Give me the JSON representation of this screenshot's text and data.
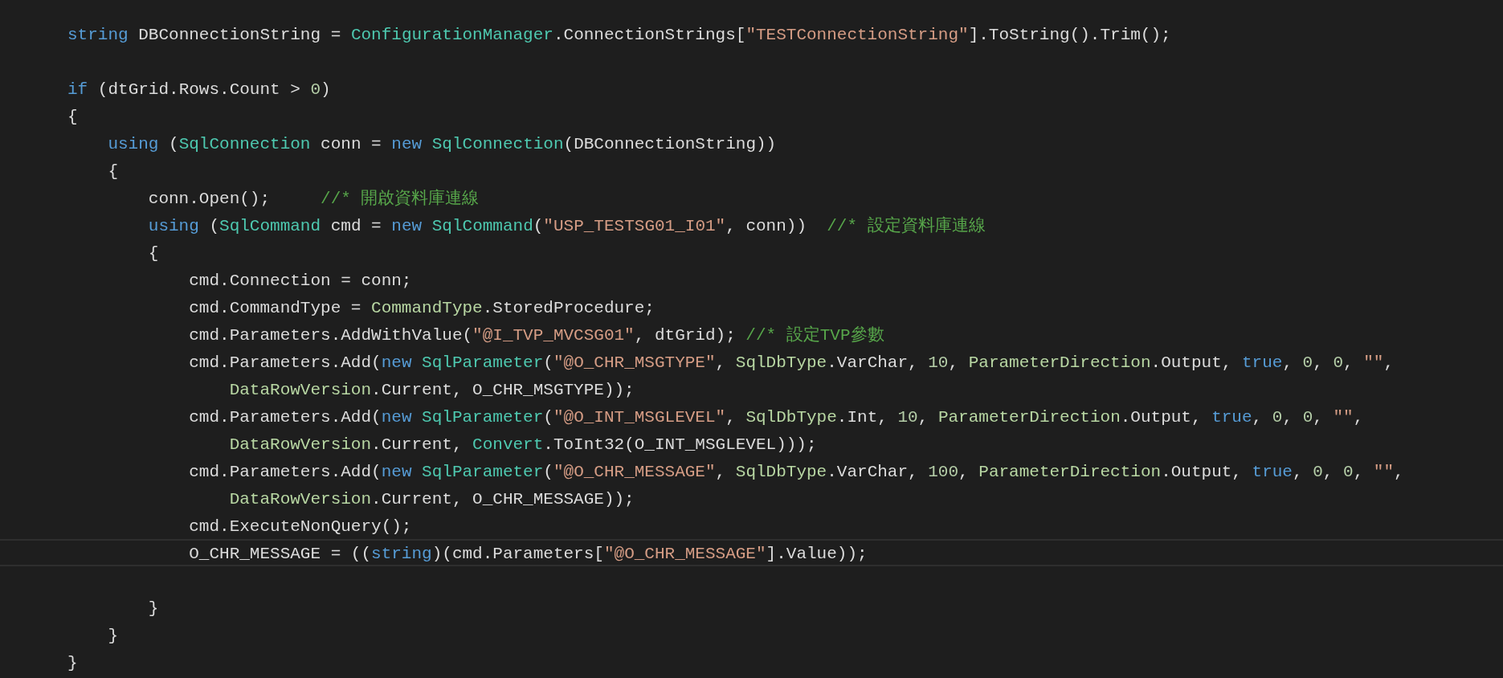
{
  "editor": {
    "lines": [
      {
        "current": false,
        "tokens": [
          {
            "kind": "keyword",
            "text": "string"
          },
          {
            "kind": "plain",
            "text": " DBConnectionString = "
          },
          {
            "kind": "type",
            "text": "ConfigurationManager"
          },
          {
            "kind": "plain",
            "text": ".ConnectionStrings["
          },
          {
            "kind": "string",
            "text": "\"TESTConnectionString\""
          },
          {
            "kind": "plain",
            "text": "].ToString().Trim();"
          }
        ]
      },
      {
        "current": false
      },
      {
        "current": false,
        "tokens": [
          {
            "kind": "keyword",
            "text": "if"
          },
          {
            "kind": "plain",
            "text": " (dtGrid.Rows.Count > "
          },
          {
            "kind": "number",
            "text": "0"
          },
          {
            "kind": "plain",
            "text": ")"
          }
        ]
      },
      {
        "current": false,
        "tokens": [
          {
            "kind": "plain",
            "text": "{"
          }
        ]
      },
      {
        "current": false,
        "tokens": [
          {
            "kind": "keyword",
            "text": "    using"
          },
          {
            "kind": "plain",
            "text": " ("
          },
          {
            "kind": "type",
            "text": "SqlConnection"
          },
          {
            "kind": "plain",
            "text": " conn = "
          },
          {
            "kind": "keyword",
            "text": "new "
          },
          {
            "kind": "type",
            "text": "SqlConnection"
          },
          {
            "kind": "plain",
            "text": "(DBConnectionString))"
          }
        ]
      },
      {
        "current": false,
        "tokens": [
          {
            "kind": "plain",
            "text": "    {"
          }
        ]
      },
      {
        "current": false,
        "tokens": [
          {
            "kind": "plain",
            "text": "        conn.Open();     "
          },
          {
            "kind": "comment",
            "text": "//* 開啟資料庫連線"
          }
        ]
      },
      {
        "current": false,
        "tokens": [
          {
            "kind": "keyword",
            "text": "        using"
          },
          {
            "kind": "plain",
            "text": " ("
          },
          {
            "kind": "type",
            "text": "SqlCommand"
          },
          {
            "kind": "plain",
            "text": " cmd = "
          },
          {
            "kind": "keyword",
            "text": "new "
          },
          {
            "kind": "type",
            "text": "SqlCommand"
          },
          {
            "kind": "plain",
            "text": "("
          },
          {
            "kind": "string",
            "text": "\"USP_TESTSG01_I01\""
          },
          {
            "kind": "plain",
            "text": ", conn))  "
          },
          {
            "kind": "comment",
            "text": "//* 設定資料庫連線"
          }
        ]
      },
      {
        "current": false,
        "tokens": [
          {
            "kind": "plain",
            "text": "        {"
          }
        ]
      },
      {
        "current": false,
        "tokens": [
          {
            "kind": "plain",
            "text": "            cmd.Connection = conn;"
          }
        ]
      },
      {
        "current": false,
        "tokens": [
          {
            "kind": "plain",
            "text": "            cmd.CommandType = "
          },
          {
            "kind": "enum",
            "text": "CommandType"
          },
          {
            "kind": "plain",
            "text": ".StoredProcedure;"
          }
        ]
      },
      {
        "current": false,
        "tokens": [
          {
            "kind": "plain",
            "text": "            cmd.Parameters.AddWithValue("
          },
          {
            "kind": "string",
            "text": "\"@I_TVP_MVCSG01\""
          },
          {
            "kind": "plain",
            "text": ", dtGrid); "
          },
          {
            "kind": "comment",
            "text": "//* 設定TVP參數"
          }
        ]
      },
      {
        "current": false,
        "tokens": [
          {
            "kind": "plain",
            "text": "            cmd.Parameters.Add("
          },
          {
            "kind": "keyword",
            "text": "new "
          },
          {
            "kind": "type",
            "text": "SqlParameter"
          },
          {
            "kind": "plain",
            "text": "("
          },
          {
            "kind": "string",
            "text": "\"@O_CHR_MSGTYPE\""
          },
          {
            "kind": "plain",
            "text": ", "
          },
          {
            "kind": "enum",
            "text": "SqlDbType"
          },
          {
            "kind": "plain",
            "text": ".VarChar, "
          },
          {
            "kind": "number",
            "text": "10"
          },
          {
            "kind": "plain",
            "text": ", "
          },
          {
            "kind": "enum",
            "text": "ParameterDirection"
          },
          {
            "kind": "plain",
            "text": ".Output, "
          },
          {
            "kind": "keyword",
            "text": "true"
          },
          {
            "kind": "plain",
            "text": ", "
          },
          {
            "kind": "number",
            "text": "0"
          },
          {
            "kind": "plain",
            "text": ", "
          },
          {
            "kind": "number",
            "text": "0"
          },
          {
            "kind": "plain",
            "text": ", "
          },
          {
            "kind": "string",
            "text": "\"\""
          },
          {
            "kind": "plain",
            "text": ","
          }
        ]
      },
      {
        "current": false,
        "tokens": [
          {
            "kind": "enum",
            "text": "                DataRowVersion"
          },
          {
            "kind": "plain",
            "text": ".Current, O_CHR_MSGTYPE));"
          }
        ]
      },
      {
        "current": false,
        "tokens": [
          {
            "kind": "plain",
            "text": "            cmd.Parameters.Add("
          },
          {
            "kind": "keyword",
            "text": "new "
          },
          {
            "kind": "type",
            "text": "SqlParameter"
          },
          {
            "kind": "plain",
            "text": "("
          },
          {
            "kind": "string",
            "text": "\"@O_INT_MSGLEVEL\""
          },
          {
            "kind": "plain",
            "text": ", "
          },
          {
            "kind": "enum",
            "text": "SqlDbType"
          },
          {
            "kind": "plain",
            "text": ".Int, "
          },
          {
            "kind": "number",
            "text": "10"
          },
          {
            "kind": "plain",
            "text": ", "
          },
          {
            "kind": "enum",
            "text": "ParameterDirection"
          },
          {
            "kind": "plain",
            "text": ".Output, "
          },
          {
            "kind": "keyword",
            "text": "true"
          },
          {
            "kind": "plain",
            "text": ", "
          },
          {
            "kind": "number",
            "text": "0"
          },
          {
            "kind": "plain",
            "text": ", "
          },
          {
            "kind": "number",
            "text": "0"
          },
          {
            "kind": "plain",
            "text": ", "
          },
          {
            "kind": "string",
            "text": "\"\""
          },
          {
            "kind": "plain",
            "text": ","
          }
        ]
      },
      {
        "current": false,
        "tokens": [
          {
            "kind": "enum",
            "text": "                DataRowVersion"
          },
          {
            "kind": "plain",
            "text": ".Current, "
          },
          {
            "kind": "type",
            "text": "Convert"
          },
          {
            "kind": "plain",
            "text": ".ToInt32(O_INT_MSGLEVEL)));"
          }
        ]
      },
      {
        "current": false,
        "tokens": [
          {
            "kind": "plain",
            "text": "            cmd.Parameters.Add("
          },
          {
            "kind": "keyword",
            "text": "new "
          },
          {
            "kind": "type",
            "text": "SqlParameter"
          },
          {
            "kind": "plain",
            "text": "("
          },
          {
            "kind": "string",
            "text": "\"@O_CHR_MESSAGE\""
          },
          {
            "kind": "plain",
            "text": ", "
          },
          {
            "kind": "enum",
            "text": "SqlDbType"
          },
          {
            "kind": "plain",
            "text": ".VarChar, "
          },
          {
            "kind": "number",
            "text": "100"
          },
          {
            "kind": "plain",
            "text": ", "
          },
          {
            "kind": "enum",
            "text": "ParameterDirection"
          },
          {
            "kind": "plain",
            "text": ".Output, "
          },
          {
            "kind": "keyword",
            "text": "true"
          },
          {
            "kind": "plain",
            "text": ", "
          },
          {
            "kind": "number",
            "text": "0"
          },
          {
            "kind": "plain",
            "text": ", "
          },
          {
            "kind": "number",
            "text": "0"
          },
          {
            "kind": "plain",
            "text": ", "
          },
          {
            "kind": "string",
            "text": "\"\""
          },
          {
            "kind": "plain",
            "text": ","
          }
        ]
      },
      {
        "current": false,
        "tokens": [
          {
            "kind": "enum",
            "text": "                DataRowVersion"
          },
          {
            "kind": "plain",
            "text": ".Current, O_CHR_MESSAGE));"
          }
        ]
      },
      {
        "current": false,
        "tokens": [
          {
            "kind": "plain",
            "text": "            cmd.ExecuteNonQuery();"
          }
        ]
      },
      {
        "current": true,
        "tokens": [
          {
            "kind": "plain",
            "text": "            O_CHR_MESSAGE = (("
          },
          {
            "kind": "keyword",
            "text": "string"
          },
          {
            "kind": "plain",
            "text": ")(cmd.Parameters["
          },
          {
            "kind": "string",
            "text": "\"@O_CHR_MESSAGE\""
          },
          {
            "kind": "plain",
            "text": "].Value));"
          }
        ]
      },
      {
        "current": false
      },
      {
        "current": false,
        "tokens": [
          {
            "kind": "plain",
            "text": "        }"
          }
        ]
      },
      {
        "current": false,
        "tokens": [
          {
            "kind": "plain",
            "text": "    }"
          }
        ]
      },
      {
        "current": false,
        "tokens": [
          {
            "kind": "plain",
            "text": "}"
          }
        ]
      }
    ]
  }
}
